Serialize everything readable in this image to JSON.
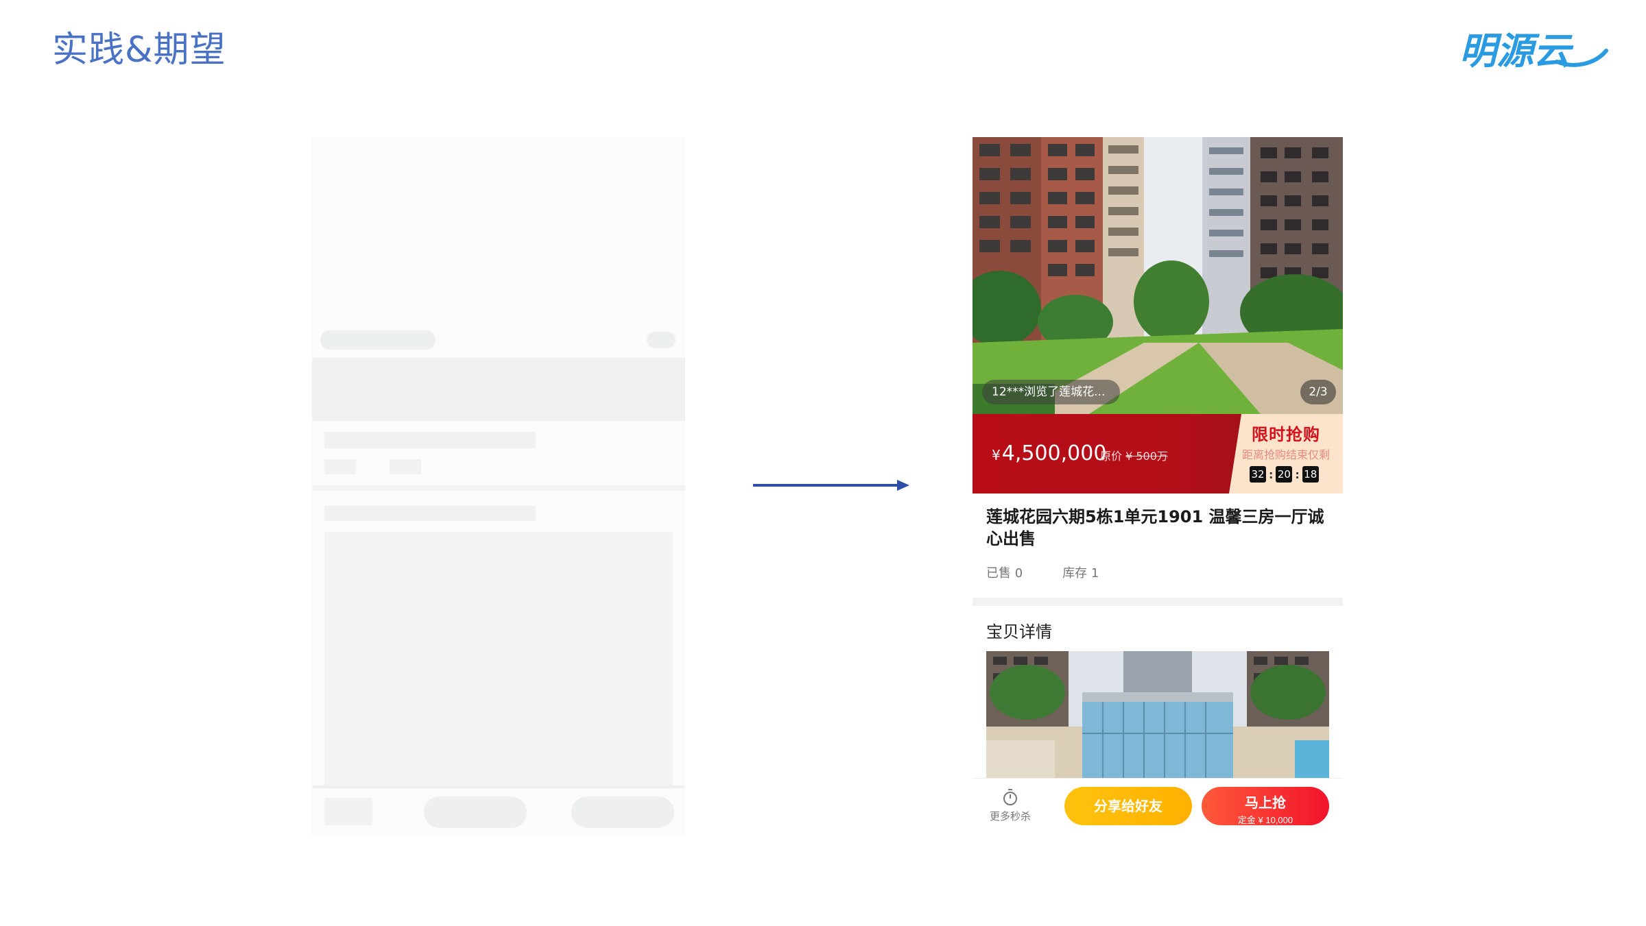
{
  "slide": {
    "title": "实践&期望"
  },
  "logo": {
    "text": "明源云"
  },
  "product_page": {
    "viewer_notice": "12***浏览了莲城花...",
    "image_counter": "2/3",
    "price": {
      "currency": "¥",
      "amount": "4,500,000",
      "original_label": "原价",
      "original_price": "¥ 500万"
    },
    "flash_sale": {
      "title": "限时抢购",
      "subtitle": "距离抢购结束仅剩",
      "countdown": [
        "32",
        "20",
        "18"
      ]
    },
    "title": "莲城花园六期5栋1单元1901 温馨三房一厅诚心出售",
    "sold": "已售 0",
    "stock": "库存 1",
    "detail_heading": "宝贝详情",
    "bottom_bar": {
      "more_label": "更多秒杀",
      "share_label": "分享给好友",
      "buy_label": "马上抢",
      "deposit_label": "定金 ¥ 10,000"
    }
  }
}
